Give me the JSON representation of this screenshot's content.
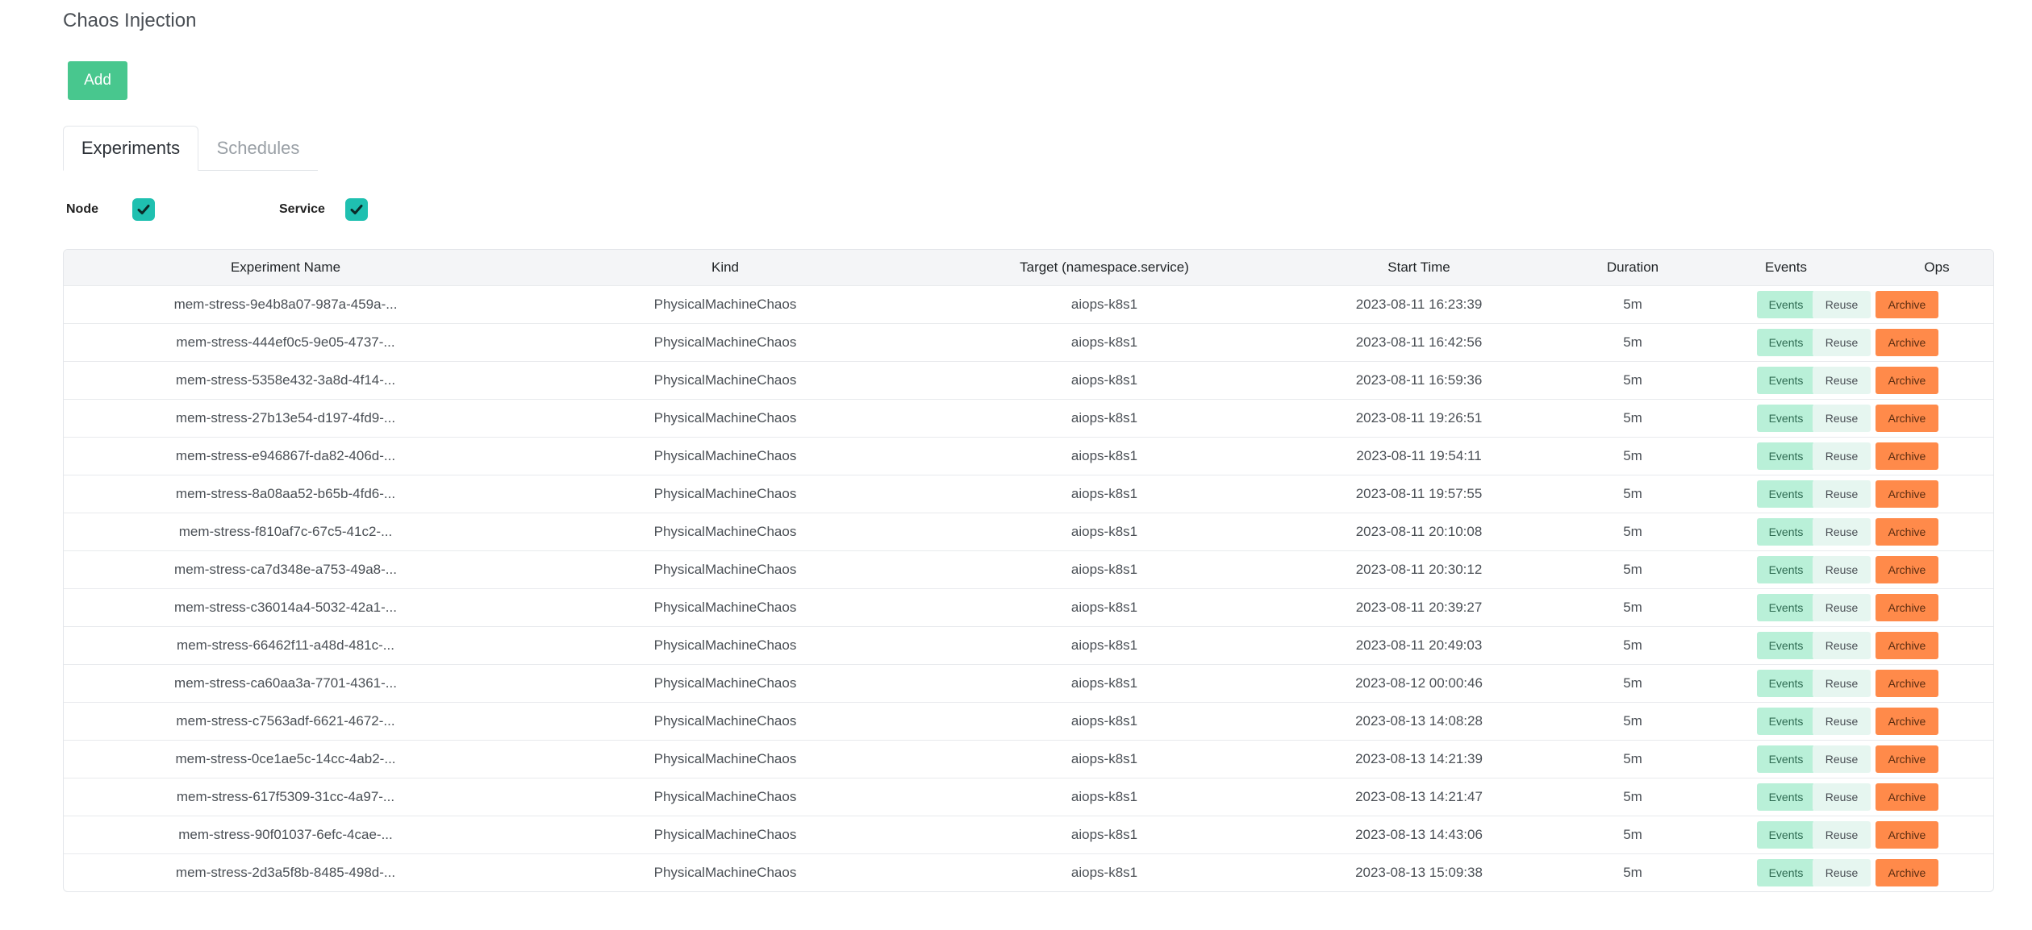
{
  "page": {
    "title": "Chaos Injection"
  },
  "toolbar": {
    "add_label": "Add"
  },
  "tabs": [
    {
      "label": "Experiments",
      "active": true
    },
    {
      "label": "Schedules",
      "active": false
    }
  ],
  "filters": [
    {
      "label": "Node",
      "checked": true
    },
    {
      "label": "Service",
      "checked": true
    }
  ],
  "table": {
    "headers": [
      "Experiment Name",
      "Kind",
      "Target (namespace.service)",
      "Start Time",
      "Duration",
      "Events",
      "Ops"
    ],
    "events_label": "Events",
    "reuse_label": "Reuse",
    "archive_label": "Archive",
    "rows": [
      {
        "name": "mem-stress-9e4b8a07-987a-459a-...",
        "kind": "PhysicalMachineChaos",
        "target": "aiops-k8s1",
        "start": "2023-08-11 16:23:39",
        "duration": "5m"
      },
      {
        "name": "mem-stress-444ef0c5-9e05-4737-...",
        "kind": "PhysicalMachineChaos",
        "target": "aiops-k8s1",
        "start": "2023-08-11 16:42:56",
        "duration": "5m"
      },
      {
        "name": "mem-stress-5358e432-3a8d-4f14-...",
        "kind": "PhysicalMachineChaos",
        "target": "aiops-k8s1",
        "start": "2023-08-11 16:59:36",
        "duration": "5m"
      },
      {
        "name": "mem-stress-27b13e54-d197-4fd9-...",
        "kind": "PhysicalMachineChaos",
        "target": "aiops-k8s1",
        "start": "2023-08-11 19:26:51",
        "duration": "5m"
      },
      {
        "name": "mem-stress-e946867f-da82-406d-...",
        "kind": "PhysicalMachineChaos",
        "target": "aiops-k8s1",
        "start": "2023-08-11 19:54:11",
        "duration": "5m"
      },
      {
        "name": "mem-stress-8a08aa52-b65b-4fd6-...",
        "kind": "PhysicalMachineChaos",
        "target": "aiops-k8s1",
        "start": "2023-08-11 19:57:55",
        "duration": "5m"
      },
      {
        "name": "mem-stress-f810af7c-67c5-41c2-...",
        "kind": "PhysicalMachineChaos",
        "target": "aiops-k8s1",
        "start": "2023-08-11 20:10:08",
        "duration": "5m"
      },
      {
        "name": "mem-stress-ca7d348e-a753-49a8-...",
        "kind": "PhysicalMachineChaos",
        "target": "aiops-k8s1",
        "start": "2023-08-11 20:30:12",
        "duration": "5m"
      },
      {
        "name": "mem-stress-c36014a4-5032-42a1-...",
        "kind": "PhysicalMachineChaos",
        "target": "aiops-k8s1",
        "start": "2023-08-11 20:39:27",
        "duration": "5m"
      },
      {
        "name": "mem-stress-66462f11-a48d-481c-...",
        "kind": "PhysicalMachineChaos",
        "target": "aiops-k8s1",
        "start": "2023-08-11 20:49:03",
        "duration": "5m"
      },
      {
        "name": "mem-stress-ca60aa3a-7701-4361-...",
        "kind": "PhysicalMachineChaos",
        "target": "aiops-k8s1",
        "start": "2023-08-12 00:00:46",
        "duration": "5m"
      },
      {
        "name": "mem-stress-c7563adf-6621-4672-...",
        "kind": "PhysicalMachineChaos",
        "target": "aiops-k8s1",
        "start": "2023-08-13 14:08:28",
        "duration": "5m"
      },
      {
        "name": "mem-stress-0ce1ae5c-14cc-4ab2-...",
        "kind": "PhysicalMachineChaos",
        "target": "aiops-k8s1",
        "start": "2023-08-13 14:21:39",
        "duration": "5m"
      },
      {
        "name": "mem-stress-617f5309-31cc-4a97-...",
        "kind": "PhysicalMachineChaos",
        "target": "aiops-k8s1",
        "start": "2023-08-13 14:21:47",
        "duration": "5m"
      },
      {
        "name": "mem-stress-90f01037-6efc-4cae-...",
        "kind": "PhysicalMachineChaos",
        "target": "aiops-k8s1",
        "start": "2023-08-13 14:43:06",
        "duration": "5m"
      },
      {
        "name": "mem-stress-2d3a5f8b-8485-498d-...",
        "kind": "PhysicalMachineChaos",
        "target": "aiops-k8s1",
        "start": "2023-08-13 15:09:38",
        "duration": "5m"
      }
    ]
  },
  "icons": {
    "checkbox": "checkmark-icon"
  },
  "colors": {
    "accent": "#48c78e",
    "checkbox": "#1fc0b0",
    "archive": "#ff8a4a",
    "events": "#b9f0d8",
    "reuse": "#e6f6f0"
  }
}
